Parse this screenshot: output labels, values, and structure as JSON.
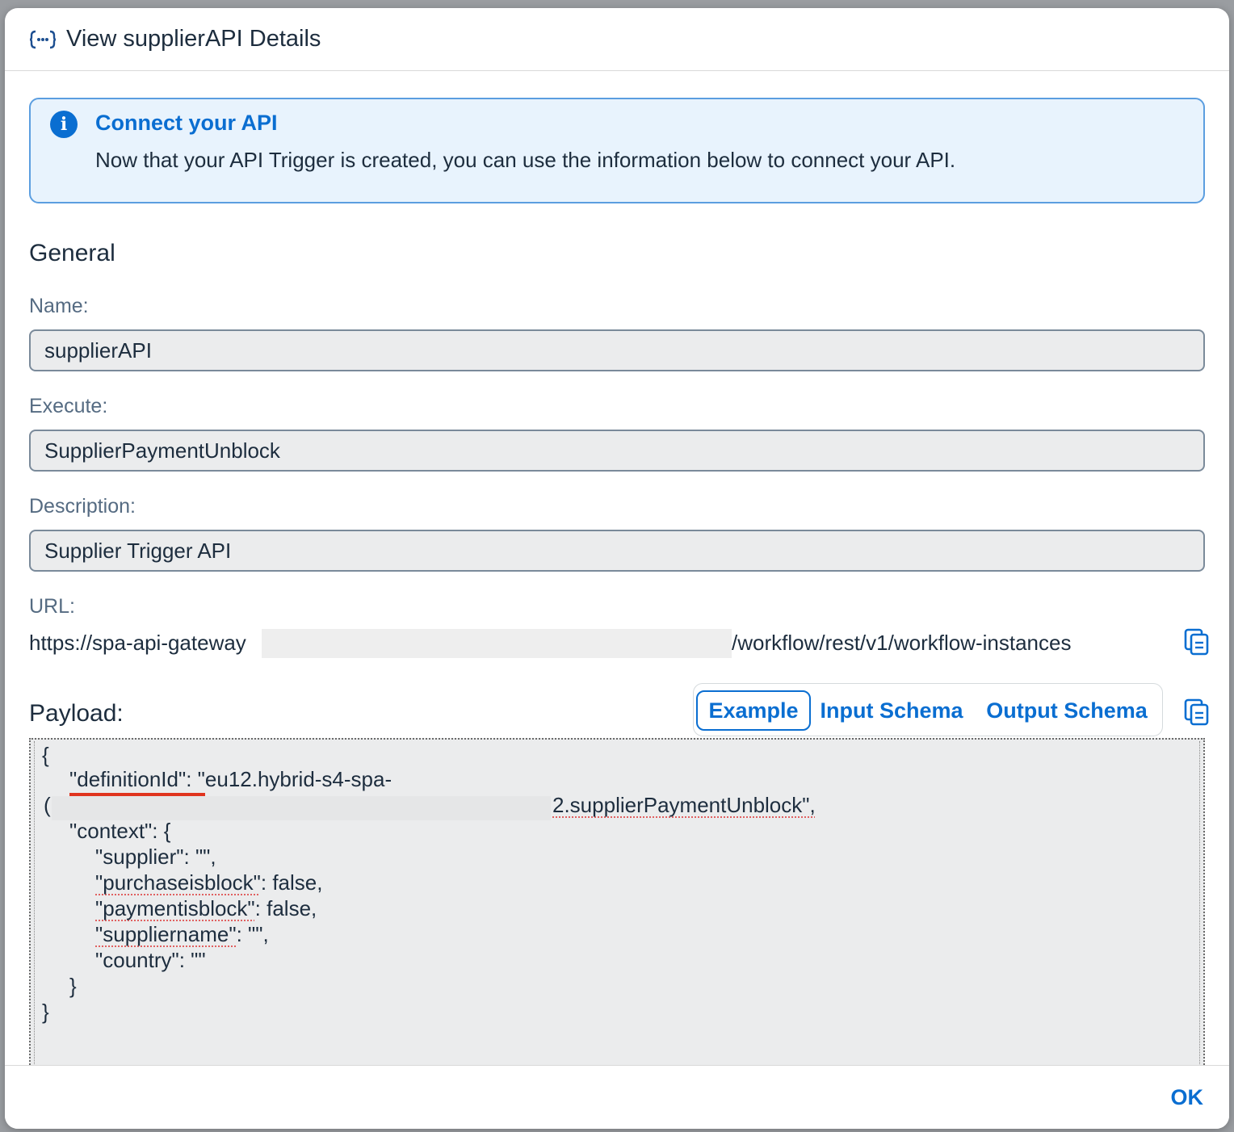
{
  "dialog": {
    "title": "View supplierAPI Details",
    "icon": "api-trigger-icon"
  },
  "info": {
    "title": "Connect your API",
    "text": "Now that your API Trigger is created, you can use the information below to connect your API."
  },
  "general": {
    "title": "General",
    "name_label": "Name:",
    "name_value": "supplierAPI",
    "execute_label": "Execute:",
    "execute_value": "SupplierPaymentUnblock",
    "description_label": "Description:",
    "description_value": "Supplier Trigger API",
    "url_label": "URL:",
    "url_prefix": "https://spa-api-gateway",
    "url_suffix": "/workflow/rest/v1/workflow-instances"
  },
  "payload": {
    "label": "Payload:",
    "tabs": [
      "Example",
      "Input Schema",
      "Output Schema"
    ],
    "selected_tab": "Example",
    "code": {
      "open_brace": "{",
      "definition_key": "\"definitionId\"",
      "definition_value_start": ": \"eu12.hybrid-s4-spa-",
      "definition_line2_start": "(",
      "definition_line2_end": "2.supplierPaymentUnblock\",",
      "context_open": "\"context\": {",
      "supplier": "\"supplier\": \"\",",
      "purchaseisblock_key": "\"purchaseisblock\"",
      "purchaseisblock_val": ": false,",
      "paymentisblock_key": "\"paymentisblock\"",
      "paymentisblock_val": ": false,",
      "suppliername_key": "\"suppliername\"",
      "suppliername_val": ": \"\",",
      "country": "\"country\": \"\"",
      "context_close": "}",
      "close_brace": "}"
    }
  },
  "footer": {
    "ok_label": "OK"
  },
  "colors": {
    "accent": "#0a6ed1",
    "info_bg": "#e8f3fd",
    "field_bg": "#ebeced",
    "error_underline": "#e0341e"
  }
}
